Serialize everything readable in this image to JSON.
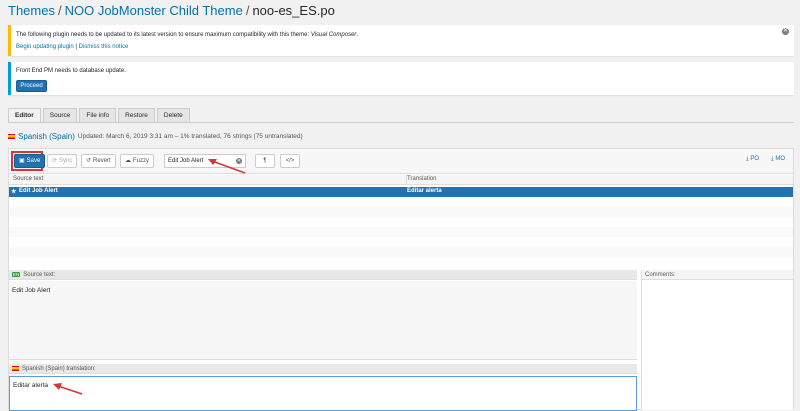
{
  "breadcrumb": {
    "themes": "Themes",
    "theme": "NOO JobMonster Child Theme",
    "file": "noo-es_ES.po",
    "separator": "/"
  },
  "notices": {
    "plugin_update": {
      "message_prefix": "The following plugin needs to be updated to its latest version to ensure maximum compatibility with this theme: ",
      "plugin_name": "Visual Composer",
      "message_suffix": ".",
      "begin_link": "Begin updating plugin",
      "link_separator": "|",
      "dismiss_link": "Dismiss this notice"
    },
    "db_update": {
      "message": "Front End PM needs to database update.",
      "button": "Proceed"
    }
  },
  "tabs": [
    "Editor",
    "Source",
    "File info",
    "Restore",
    "Delete"
  ],
  "language": {
    "name": "Spanish (Spain)",
    "meta": "Updated: March 6, 2019 3:31 am – 1% translated, 76 strings (75 untranslated)"
  },
  "toolbar": {
    "save": "Save",
    "sync": "Sync",
    "revert": "Revert",
    "fuzzy": "Fuzzy",
    "search_value": "Edit Job Alert",
    "pilcrow": "¶",
    "code": "</>",
    "po": "PO",
    "mo": "MO"
  },
  "grid": {
    "col_source": "Source text",
    "col_translation": "Translation",
    "rows": [
      {
        "source": "Edit Job Alert",
        "translation": "Editar alerta"
      }
    ]
  },
  "editor": {
    "source_label": "Source text:",
    "source_badge": "EN",
    "source_text": "Edit Job Alert",
    "comments_label": "Comments:",
    "translation_label": "Spanish (Spain) translation:",
    "translation_text": "Editar alerta"
  },
  "colors": {
    "accent": "#2271b1",
    "link": "#0073aa",
    "warning": "#ffb900",
    "info": "#00a0d2",
    "annotation": "#d63638"
  }
}
